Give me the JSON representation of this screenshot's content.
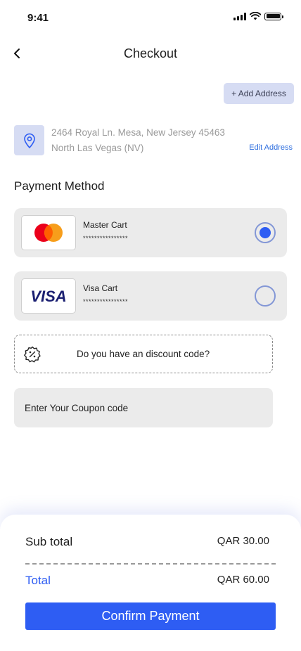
{
  "status_bar": {
    "time": "9:41"
  },
  "header": {
    "title": "Checkout"
  },
  "address": {
    "add_label": "+ Add Address",
    "line1": "2464 Royal Ln. Mesa, New Jersey 45463",
    "line2": "North Las Vegas (NV)",
    "edit_label": "Edit Address"
  },
  "payment": {
    "section_title": "Payment Method",
    "options": [
      {
        "name": "Master Cart",
        "masked": "****************",
        "selected": true,
        "logo": "mastercard-logo"
      },
      {
        "name": "Visa Cart",
        "masked": "****************",
        "selected": false,
        "logo": "visa-logo",
        "logo_text": "VISA"
      }
    ]
  },
  "discount": {
    "prompt": "Do you have an discount code?"
  },
  "coupon": {
    "placeholder": "Enter Your Coupon code"
  },
  "summary": {
    "subtotal_label": "Sub total",
    "subtotal_value": "QAR 30.00",
    "total_label": "Total",
    "total_value": "QAR 60.00",
    "confirm_label": "Confirm Payment"
  },
  "colors": {
    "accent": "#2e5df3",
    "chip": "#d6dcf3",
    "card_bg": "#ebebeb",
    "link": "#2f6fdf"
  }
}
